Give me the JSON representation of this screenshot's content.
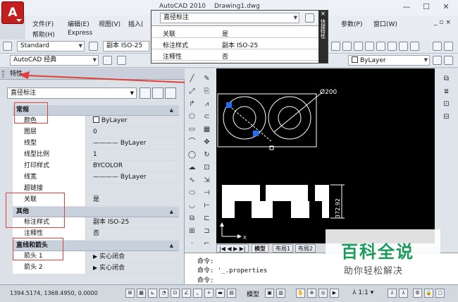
{
  "window": {
    "app_title": "AutoCAD 2010",
    "document_title": "Drawing1.dwg",
    "app_menu_glyph": "A",
    "controls": {
      "minimize": "—",
      "maximize": "☐",
      "close": "✕"
    }
  },
  "menubar": {
    "items": [
      "文件(F)",
      "编辑(E)",
      "视图(V)",
      "插入(",
      "参数(P)",
      "窗口(W)",
      "帮助(H)",
      "Express"
    ],
    "doc_controls": "_ ▫ ×"
  },
  "toolbar": {
    "text_style": "Standard",
    "dim_style": "副本 ISO-25",
    "workspace": "AutoCAD 经典",
    "layer": "ByLayer"
  },
  "quick_popup": {
    "type": "直径标注",
    "rows": [
      {
        "key": "关联",
        "value": "是"
      },
      {
        "key": "标注样式",
        "value": "副本 ISO-25"
      },
      {
        "key": "注释性",
        "value": "否"
      }
    ],
    "close": "×",
    "side_label": "快捷特性"
  },
  "properties": {
    "title": "特性",
    "object_type": "直径标注",
    "sections": [
      {
        "name": "常规",
        "rows": [
          {
            "key": "颜色",
            "value": "ByLayer",
            "swatch": true
          },
          {
            "key": "图层",
            "value": "0"
          },
          {
            "key": "线型",
            "value": "———— ByLayer"
          },
          {
            "key": "线型比例",
            "value": "1"
          },
          {
            "key": "打印样式",
            "value": "BYCOLOR"
          },
          {
            "key": "线宽",
            "value": "———— ByLayer"
          },
          {
            "key": "超链接",
            "value": ""
          },
          {
            "key": "关联",
            "value": "是"
          }
        ]
      },
      {
        "name": "其他",
        "rows": [
          {
            "key": "标注样式",
            "value": "副本 ISO-25"
          },
          {
            "key": "注释性",
            "value": "否"
          }
        ]
      },
      {
        "name": "直线和箭头",
        "rows": [
          {
            "key": "箭头 1",
            "value": "实心闭合",
            "arrow_icon": true
          },
          {
            "key": "箭头 2",
            "value": "实心闭合",
            "arrow_icon": true
          }
        ]
      }
    ]
  },
  "drawing": {
    "diameter_label": "Ø200",
    "vertical_dim_label": "372.92",
    "colors": {
      "background": "#000000",
      "lines": "#ffffff",
      "grip": "#1f6fff"
    }
  },
  "layout_tabs": [
    "模型",
    "布局1",
    "布局2"
  ],
  "command_line": {
    "lines": [
      "命令:",
      "命令:  '_.properties",
      "命令:"
    ]
  },
  "statusbar": {
    "coordinates": "1394.5174,  1368.4950,  0.0000",
    "model_label": "模型",
    "scale": "1:1"
  },
  "watermark": {
    "title": "百科全说",
    "subtitle": "助你轻松解决"
  }
}
